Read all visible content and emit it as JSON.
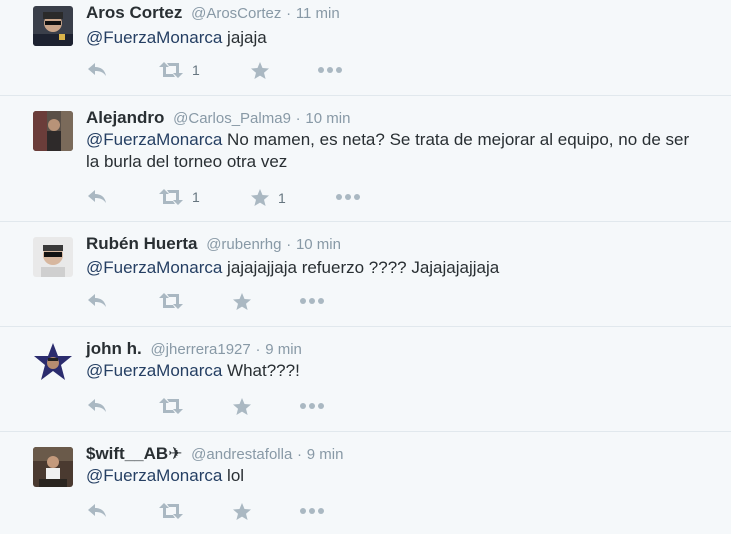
{
  "tweets": [
    {
      "name": "Aros Cortez",
      "handle": "@ArosCortez",
      "separator": "·",
      "time": "11 min",
      "mention": "@FuerzaMonarca",
      "text": " jajaja",
      "retweet_count": "1",
      "favorite_count": ""
    },
    {
      "name": "Alejandro",
      "handle": "@Carlos_Palma9",
      "separator": "·",
      "time": "10 min",
      "mention": "@FuerzaMonarca",
      "text": " No mamen, es neta? Se trata de mejorar al equipo, no de ser la burla del torneo otra vez",
      "retweet_count": "1",
      "favorite_count": "1"
    },
    {
      "name": "Rubén Huerta",
      "handle": "@rubenrhg",
      "separator": "·",
      "time": "10 min",
      "mention": "@FuerzaMonarca",
      "text": " jajajajjaja refuerzo ???? Jajajajajjaja",
      "retweet_count": "",
      "favorite_count": ""
    },
    {
      "name": "john h.",
      "handle": "@jherrera1927",
      "separator": "·",
      "time": "9 min",
      "mention": "@FuerzaMonarca",
      "text": " What???!",
      "retweet_count": "",
      "favorite_count": ""
    },
    {
      "name": "$wift__AB✈",
      "handle": "@andrestafolla",
      "separator": "·",
      "time": "9 min",
      "mention": "@FuerzaMonarca",
      "text": " lol",
      "retweet_count": "",
      "favorite_count": ""
    }
  ],
  "colors": {
    "background": "#f5f8fa",
    "mention": "#253f63",
    "muted": "#8899a6",
    "icon": "#aab8c2",
    "divider": "#e1e8ed"
  },
  "icons": [
    "reply-icon",
    "retweet-icon",
    "favorite-icon",
    "more-icon"
  ]
}
